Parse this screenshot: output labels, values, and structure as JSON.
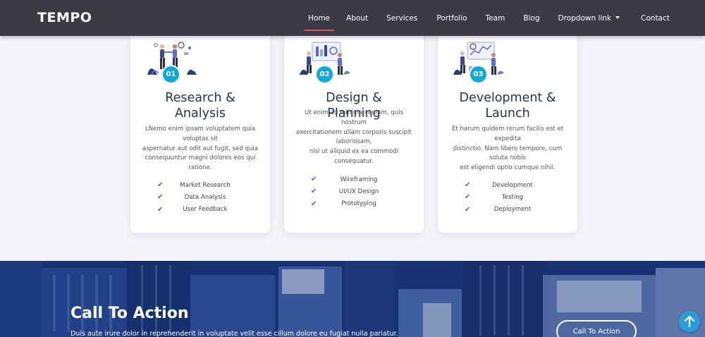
{
  "nav": {
    "brand": "TEMPO",
    "items": [
      {
        "label": "Home",
        "active": true
      },
      {
        "label": "About"
      },
      {
        "label": "Services"
      },
      {
        "label": "Portfolio"
      },
      {
        "label": "Team"
      },
      {
        "label": "Blog"
      },
      {
        "label": "Dropdown link",
        "dropdown": true
      },
      {
        "label": "Contact"
      }
    ]
  },
  "cards": [
    {
      "number": "01",
      "title_line1": "Research &",
      "title_line2": "Analysis",
      "text": [
        "LNemo enim ipsam voluptatem quia",
        "voluptas sit",
        "aspernatur aut odit aut fugit, sed quia",
        "consequuntur magni dolores eos qui",
        "ratione."
      ],
      "features": [
        "Market Research",
        "Data Analysis",
        "User Feedback"
      ]
    },
    {
      "number": "02",
      "title_line1": "Design & Planning",
      "title_line2": "",
      "text": [
        "Ut enim ad minima veniam, quis",
        "nostrum",
        "exercitationem ullam corporis suscipit",
        "laboriosam,",
        "nisi ut aliquid ex ea commodi",
        "consequatur."
      ],
      "features": [
        "Wireframing",
        "UI/UX Design",
        "Prototyping"
      ]
    },
    {
      "number": "03",
      "title_line1": "Development &",
      "title_line2": "Launch",
      "text": [
        "Et harum quidem rerum facilis est et",
        "expedita",
        "distinctio. Nam libero tempore, cum",
        "soluta nobis",
        "est eligendi optio cumque nihil."
      ],
      "features": [
        "Development",
        "Testing",
        "Deployment"
      ]
    }
  ],
  "cta": {
    "title": "Call To Action",
    "text": "Duis aute irure dolor in reprehenderit in voluptate velit esse cillum dolore eu fugiat nulla pariatur.",
    "button": "Call To Action"
  },
  "colors": {
    "nav_bg": "#3a3b47",
    "accent": "#13a8d6",
    "check": "#5c5fc2",
    "title": "#1f3556",
    "active_underline": "#d45a5a"
  },
  "icons": [
    "check-icon",
    "arrow-up-icon",
    "caret-down-icon"
  ]
}
